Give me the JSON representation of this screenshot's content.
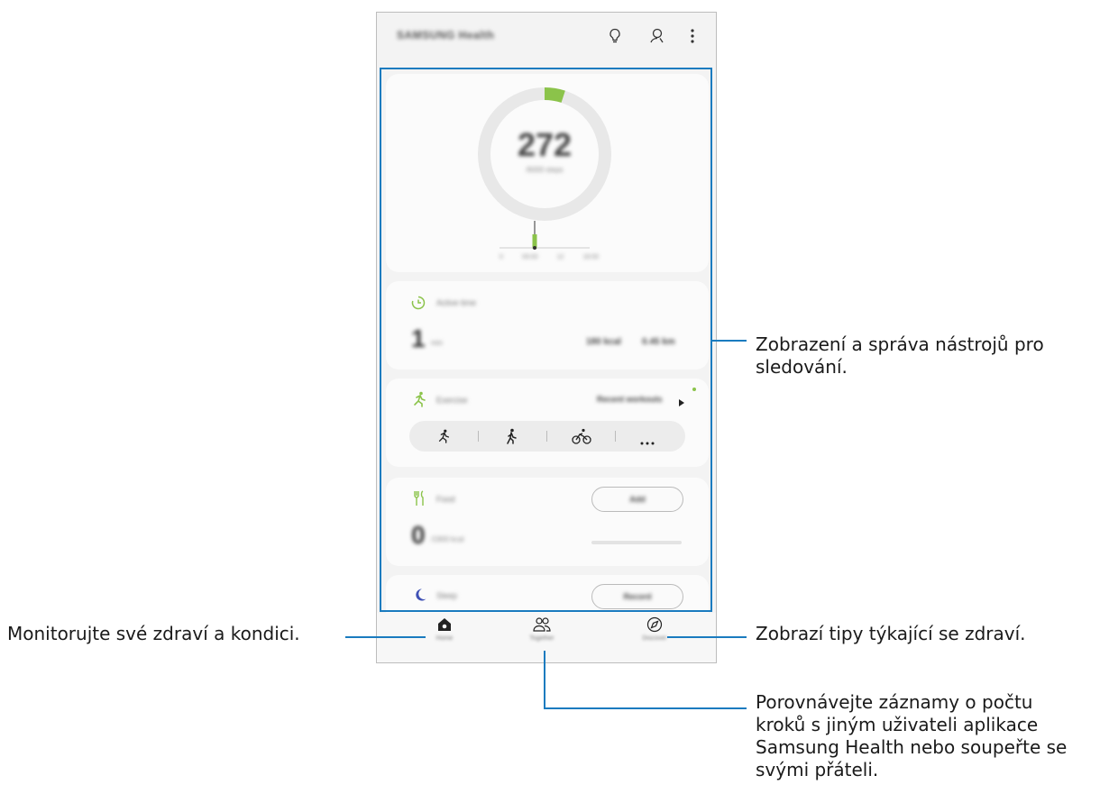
{
  "app": {
    "title": "SAMSUNG Health",
    "top_icons": [
      "lightbulb-icon",
      "person-search-icon",
      "more-vertical-icon"
    ]
  },
  "steps": {
    "count": "272",
    "goal_label": "/6000 steps",
    "axis_labels": [
      "0",
      "09:00",
      "12",
      "18:00"
    ],
    "ring_progress": 0.05,
    "ring_color": "#8bc34a"
  },
  "active_time": {
    "title": "Active time",
    "value": "1",
    "unit": "min",
    "secondary_value": "180 kcal",
    "distance": "0.45 km",
    "icon": "clock-icon"
  },
  "exercise": {
    "title": "Exercise",
    "action": "Recent workouts",
    "icon": "running-icon",
    "quick_icons": [
      "running-icon",
      "walking-icon",
      "cycling-icon",
      "more-horizontal-icon"
    ]
  },
  "food": {
    "title": "Food",
    "button": "Add",
    "value": "0",
    "unit": "/1900 kcal",
    "icon": "cutlery-icon"
  },
  "sleep": {
    "title": "Sleep",
    "button": "Record",
    "icon": "moon-icon"
  },
  "bottom_nav": [
    {
      "label": "Home",
      "icon": "home-icon"
    },
    {
      "label": "Together",
      "icon": "people-icon"
    },
    {
      "label": "Discover",
      "icon": "compass-icon"
    }
  ],
  "callouts": {
    "trackers": [
      "Zobrazení a správa nástrojů pro",
      "sledování."
    ],
    "monitor": "Monitorujte své zdraví a kondici.",
    "tips": "Zobrazí tipy týkající se zdraví.",
    "compare": [
      "Porovnávejte záznamy o počtu",
      "kroků s jiným uživateli aplikace",
      "Samsung Health nebo soupeřte se",
      "svými přáteli."
    ]
  },
  "colors": {
    "accent_green": "#8bc34a",
    "highlight_blue": "#1a7bbf",
    "callout_line": "#1a7bbf"
  }
}
